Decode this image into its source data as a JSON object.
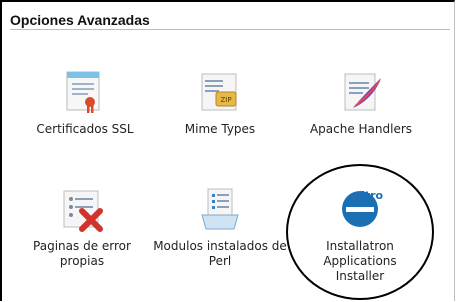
{
  "section": {
    "title": "Opciones Avanzadas"
  },
  "items": [
    {
      "label": "Certificados SSL",
      "icon": "certificate-icon"
    },
    {
      "label": "Mime Types",
      "icon": "zip-file-icon"
    },
    {
      "label": "Apache Handlers",
      "icon": "feather-document-icon"
    },
    {
      "label": "Paginas de error propias",
      "icon": "error-page-icon"
    },
    {
      "label": "Modulos instalados de Perl",
      "icon": "perl-modules-icon"
    },
    {
      "label": "Installatron Applications Installer",
      "icon": "installatron-icon"
    }
  ],
  "installatron_logo_text": "itron"
}
